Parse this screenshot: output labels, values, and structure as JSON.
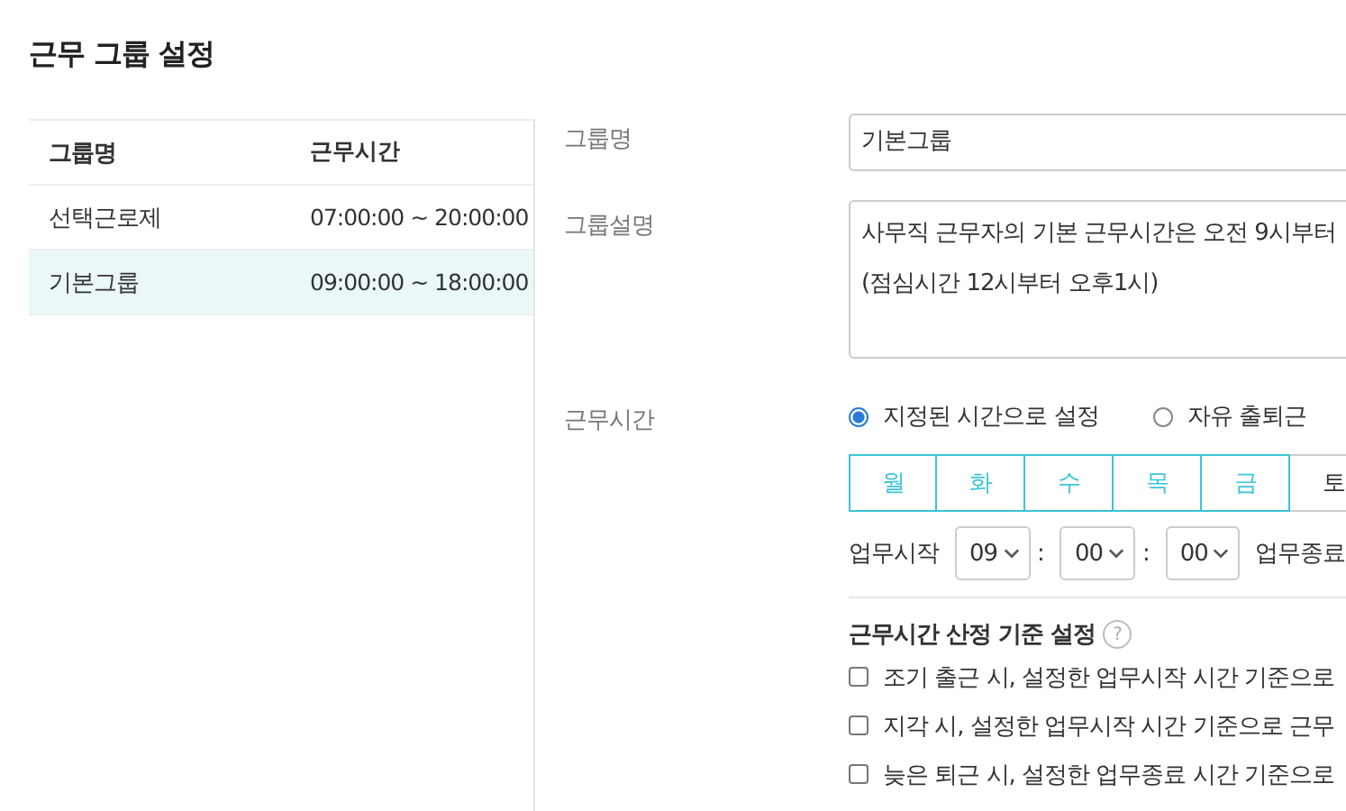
{
  "title": "근무 그룹 설정",
  "group_table": {
    "columns": [
      "그룹명",
      "근무시간"
    ],
    "rows": [
      {
        "name": "선택근로제",
        "hours": "07:00:00 ~ 20:00:00",
        "selected": false
      },
      {
        "name": "기본그룹",
        "hours": "09:00:00 ~ 18:00:00",
        "selected": true
      }
    ]
  },
  "form": {
    "name_label": "그룹명",
    "name_value": "기본그룹",
    "desc_label": "그룹설명",
    "desc_lines": [
      "사무직 근무자의 기본 근무시간은 오전 9시부터",
      "(점심시간 12시부터  오후1시)"
    ],
    "hours_label": "근무시간",
    "modes": [
      {
        "label": "지정된 시간으로 설정",
        "selected": true
      },
      {
        "label": "자유 출퇴근",
        "selected": false
      }
    ],
    "days": [
      {
        "label": "월",
        "selected": true
      },
      {
        "label": "화",
        "selected": true
      },
      {
        "label": "수",
        "selected": true
      },
      {
        "label": "목",
        "selected": true
      },
      {
        "label": "금",
        "selected": true
      },
      {
        "label": "토",
        "selected": false
      }
    ],
    "start_label": "업무시작",
    "start_time": [
      "09",
      "00",
      "00"
    ],
    "separator": ":",
    "end_label": "업무종료",
    "criteria_title": "근무시간 산정 기준 설정",
    "help": "?",
    "criteria": [
      {
        "label": "조기 출근 시, 설정한 업무시작 시간 기준으로",
        "checked": false
      },
      {
        "label": "지각 시, 설정한 업무시작 시간 기준으로 근무",
        "checked": false
      },
      {
        "label": "늦은 퇴근 시, 설정한 업무종료 시간 기준으로",
        "checked": false
      }
    ]
  }
}
